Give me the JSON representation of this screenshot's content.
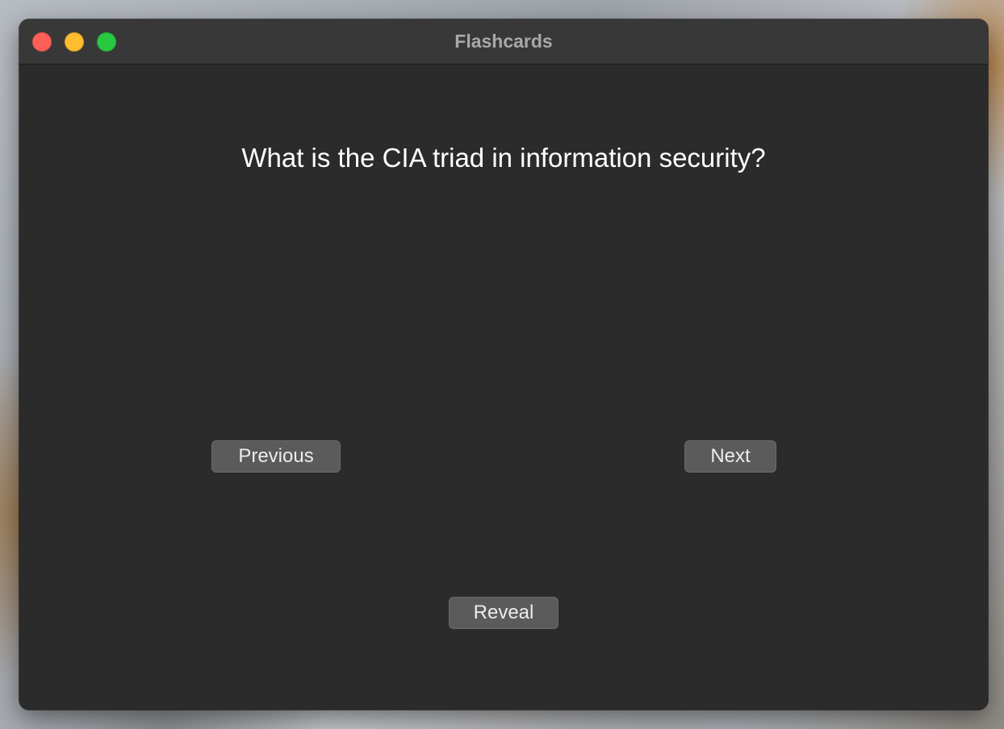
{
  "window": {
    "title": "Flashcards",
    "controls": {
      "close_color": "#fe5f57",
      "minimize_color": "#febc2e",
      "maximize_color": "#28c840"
    }
  },
  "card": {
    "question": "What is the CIA triad in information security?"
  },
  "buttons": {
    "previous_label": "Previous",
    "next_label": "Next",
    "reveal_label": "Reveal"
  }
}
